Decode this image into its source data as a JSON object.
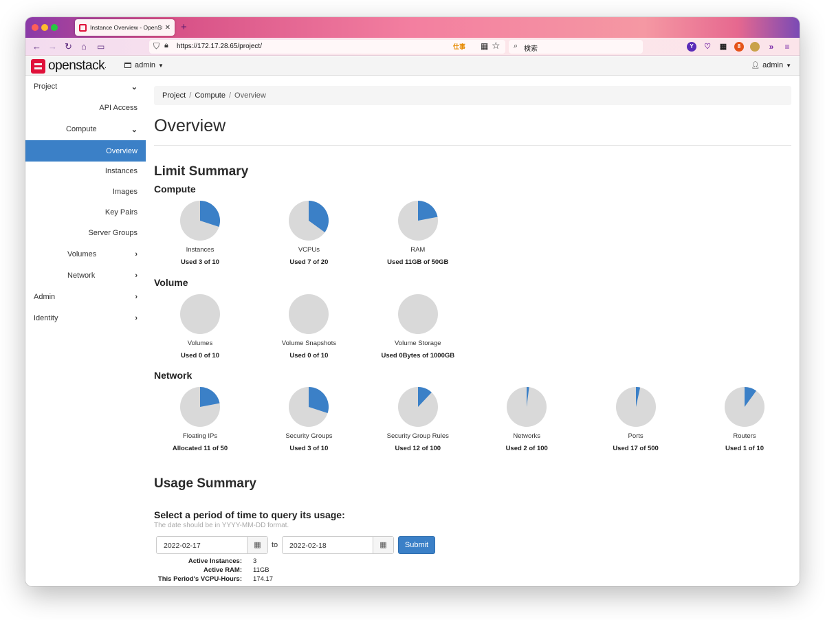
{
  "browser": {
    "tab_title": "Instance Overview - OpenStack",
    "url": "https://172.17.28.65/project/",
    "search_placeholder": "検索",
    "url_ext_label": "仕事",
    "ext_labels": [
      "Y",
      "8"
    ]
  },
  "header": {
    "logo_text": "openstack",
    "project_name": "admin",
    "user_name": "admin"
  },
  "sidebar": {
    "items": [
      {
        "label": "Project"
      },
      {
        "label": "API Access"
      },
      {
        "label": "Compute"
      },
      {
        "label": "Overview"
      },
      {
        "label": "Instances"
      },
      {
        "label": "Images"
      },
      {
        "label": "Key Pairs"
      },
      {
        "label": "Server Groups"
      },
      {
        "label": "Volumes"
      },
      {
        "label": "Network"
      },
      {
        "label": "Admin"
      },
      {
        "label": "Identity"
      }
    ]
  },
  "breadcrumb": [
    "Project",
    "Compute",
    "Overview"
  ],
  "page_title": "Overview",
  "limit_summary": {
    "title": "Limit Summary",
    "sections": [
      {
        "title": "Compute",
        "charts": [
          {
            "label": "Instances",
            "usage": "Used 3 of 10",
            "used": 3,
            "total": 10
          },
          {
            "label": "VCPUs",
            "usage": "Used 7 of 20",
            "used": 7,
            "total": 20
          },
          {
            "label": "RAM",
            "usage": "Used 11GB of 50GB",
            "used": 11,
            "total": 50
          }
        ]
      },
      {
        "title": "Volume",
        "charts": [
          {
            "label": "Volumes",
            "usage": "Used 0 of 10",
            "used": 0,
            "total": 10
          },
          {
            "label": "Volume Snapshots",
            "usage": "Used 0 of 10",
            "used": 0,
            "total": 10
          },
          {
            "label": "Volume Storage",
            "usage": "Used 0Bytes of 1000GB",
            "used": 0,
            "total": 1000
          }
        ]
      },
      {
        "title": "Network",
        "charts": [
          {
            "label": "Floating IPs",
            "usage": "Allocated 11 of 50",
            "used": 11,
            "total": 50
          },
          {
            "label": "Security Groups",
            "usage": "Used 3 of 10",
            "used": 3,
            "total": 10
          },
          {
            "label": "Security Group Rules",
            "usage": "Used 12 of 100",
            "used": 12,
            "total": 100
          },
          {
            "label": "Networks",
            "usage": "Used 2 of 100",
            "used": 2,
            "total": 100
          },
          {
            "label": "Ports",
            "usage": "Used 17 of 500",
            "used": 17,
            "total": 500
          },
          {
            "label": "Routers",
            "usage": "Used 1 of 10",
            "used": 1,
            "total": 10
          }
        ]
      }
    ]
  },
  "usage_summary": {
    "title": "Usage Summary",
    "query_title": "Select a period of time to query its usage:",
    "help_text": "The date should be in YYYY-MM-DD format.",
    "start_date": "2022-02-17",
    "to_label": "to",
    "end_date": "2022-02-18",
    "submit_label": "Submit",
    "stats": [
      {
        "label": "Active Instances:",
        "value": "3"
      },
      {
        "label": "Active RAM:",
        "value": "11GB"
      },
      {
        "label": "This Period's VCPU-Hours:",
        "value": "174.17"
      }
    ]
  },
  "colors": {
    "accent": "#3b80c7",
    "pie_empty": "#d9d9d9",
    "brand": "#e0113a"
  }
}
